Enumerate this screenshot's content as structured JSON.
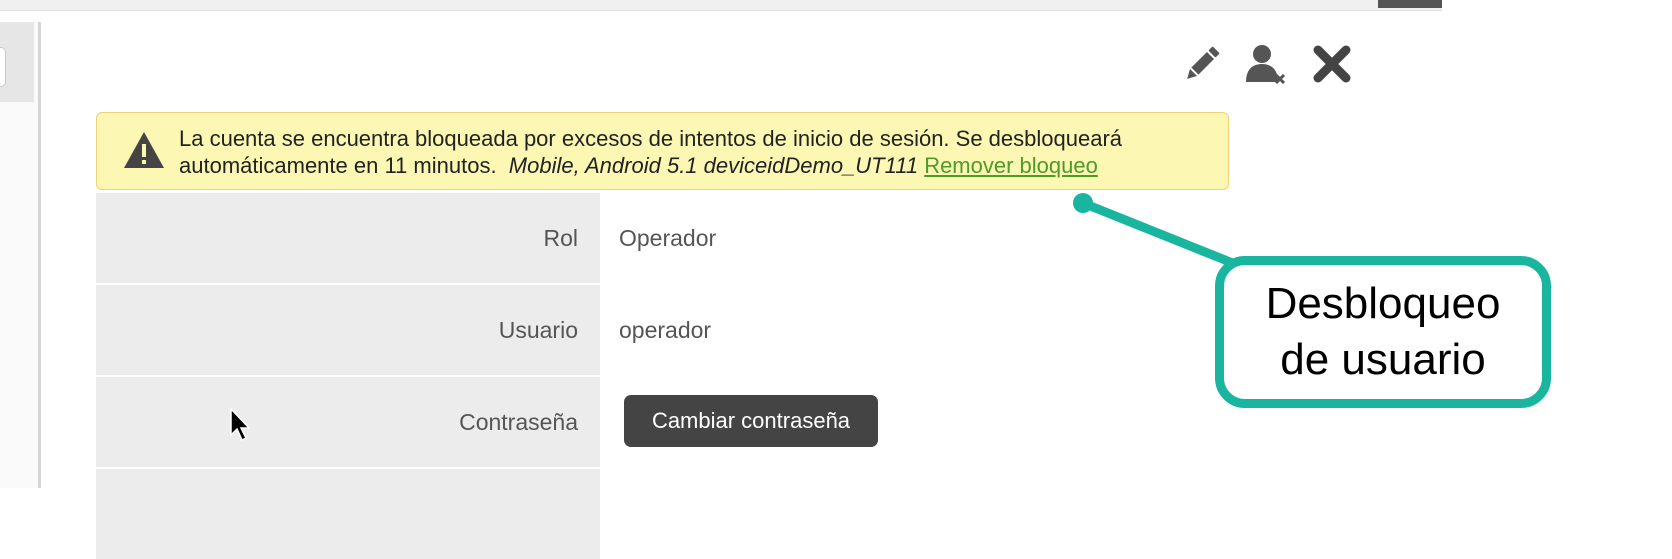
{
  "toolbar": {
    "edit_icon": "pencil-icon",
    "user_remove_icon": "user-remove-icon",
    "close_icon": "close-icon"
  },
  "alert": {
    "icon": "warning-icon",
    "message": "La cuenta se encuentra bloqueada por excesos de intentos de inicio de sesión. Se desbloqueará automáticamente en 11 minutos.",
    "device": "Mobile, Android 5.1 deviceidDemo_UT111",
    "link_label": "Remover bloqueo",
    "background": "#fcf8b3",
    "link_color": "#4f9a2a"
  },
  "form": {
    "rows": [
      {
        "label": "Rol",
        "value": "Operador"
      },
      {
        "label": "Usuario",
        "value": "operador"
      },
      {
        "label": "Contraseña",
        "button_label": "Cambiar contraseña"
      }
    ]
  },
  "callout": {
    "text": "Desbloqueo\nde usuario",
    "color": "#1ab59f"
  }
}
